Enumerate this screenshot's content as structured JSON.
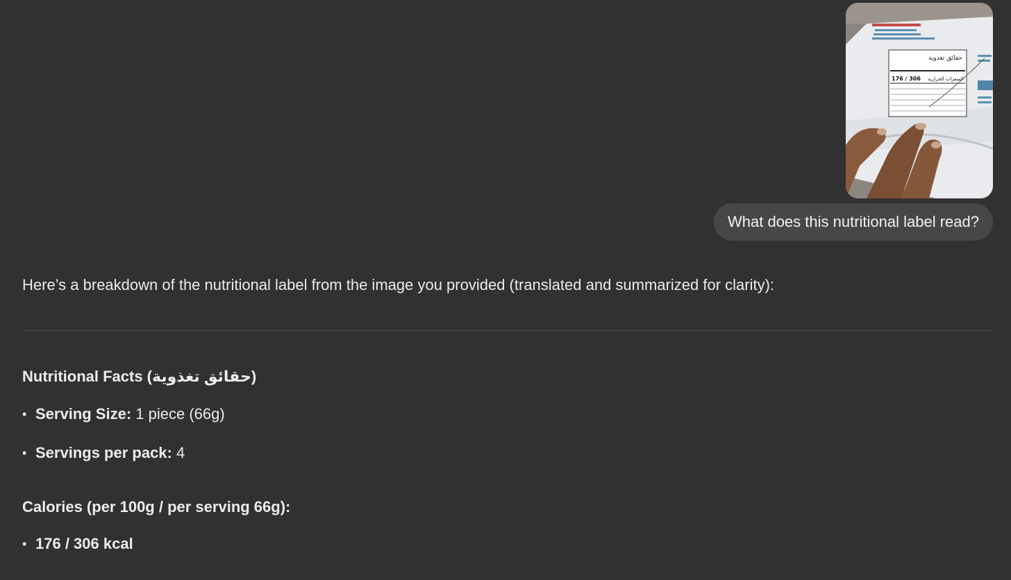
{
  "conversation": {
    "user_message": {
      "attachment_alt": "nutritional label photo",
      "text": "What does this nutritional label read?"
    },
    "assistant_message": {
      "intro": "Here’s a breakdown of the nutritional label from the image you provided (translated and summarized for clarity):",
      "section_1": {
        "heading": "Nutritional Facts (حقائق تغذوية)",
        "items": [
          {
            "label": "Serving Size:",
            "value": " 1 piece (66g)"
          },
          {
            "label": "Servings per pack:",
            "value": " 4"
          }
        ]
      },
      "section_2": {
        "heading": "Calories (per 100g / per serving 66g):",
        "items": [
          {
            "label": "176 / 306 kcal",
            "value": ""
          }
        ]
      }
    }
  },
  "photo_text": {
    "arabic_title": "حقائق تغذوية",
    "calories_value": "176 / 306",
    "calories_arabic": "السعرات الحرارية"
  },
  "colors": {
    "background": "#313131",
    "bubble": "#474747",
    "text": "#ececec",
    "divider": "#4d4d4d"
  }
}
